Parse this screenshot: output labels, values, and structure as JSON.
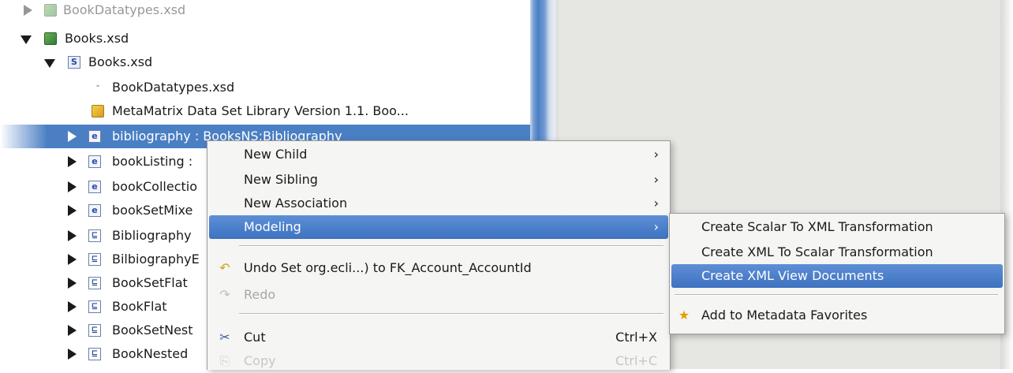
{
  "tree": {
    "items": [
      {
        "label": "BookDatatypes.xsd"
      },
      {
        "label": "Books.xsd"
      },
      {
        "label": "Books.xsd"
      },
      {
        "label": "BookDatatypes.xsd"
      },
      {
        "label": "MetaMatrix Data Set Library Version 1.1. Boo..."
      },
      {
        "label": "bibliography : BooksNS:Bibliography"
      },
      {
        "label": "bookListing :"
      },
      {
        "label": "bookCollectio"
      },
      {
        "label": "bookSetMixe"
      },
      {
        "label": "Bibliography"
      },
      {
        "label": "BilbiographyE"
      },
      {
        "label": "BookSetFlat"
      },
      {
        "label": "BookFlat"
      },
      {
        "label": "BookSetNest"
      },
      {
        "label": "BookNested"
      }
    ],
    "icon_letters": {
      "s": "S",
      "e": "e",
      "t": "⊑"
    }
  },
  "context_menu": {
    "new_child": "New Child",
    "new_sibling": "New Sibling",
    "new_association": "New Association",
    "modeling": "Modeling",
    "undo": "Undo Set org.ecli...) to FK_Account_AccountId",
    "redo": "Redo",
    "cut": "Cut",
    "cut_accel": "Ctrl+X",
    "copy": "Copy",
    "copy_accel": "Ctrl+C"
  },
  "submenu": {
    "create_scalar_to_xml": "Create Scalar To XML Transformation",
    "create_xml_to_scalar": "Create XML To Scalar Transformation",
    "create_xml_view_documents": "Create XML View Documents",
    "add_to_favorites": "Add to Metadata Favorites"
  },
  "colors": {
    "selection": "#4a7fc4",
    "menu_bg": "#f5f5f3",
    "right_panel_bg": "#e6e6e3"
  }
}
